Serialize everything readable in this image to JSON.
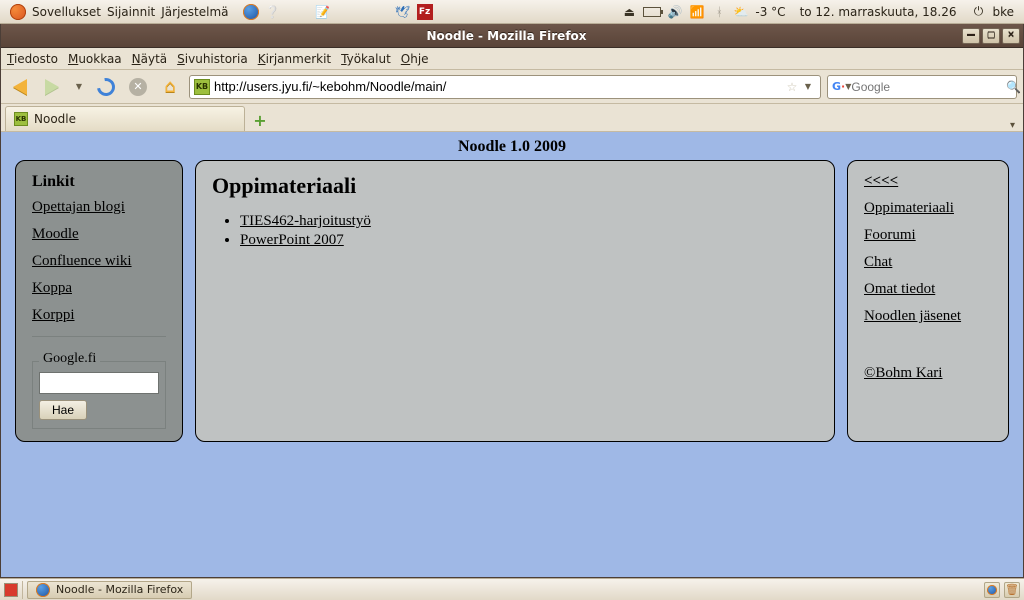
{
  "panel": {
    "menus": [
      "Sovellukset",
      "Sijainnit",
      "Järjestelmä"
    ],
    "temp": "-3 °C",
    "date": "to 12. marraskuuta, 18.26",
    "user": "bke"
  },
  "window": {
    "title": "Noodle - Mozilla Firefox",
    "menus": [
      {
        "accel": "T",
        "label": "iedosto"
      },
      {
        "accel": "M",
        "label": "uokkaa"
      },
      {
        "accel": "N",
        "label": "äytä"
      },
      {
        "accel": "S",
        "label": "ivuhistoria"
      },
      {
        "accel": "K",
        "label": "irjanmerkit"
      },
      {
        "accel": "T",
        "label": "yökalut"
      },
      {
        "accel": "O",
        "label": "hje"
      }
    ],
    "url": "http://users.jyu.fi/~kebohm/Noodle/main/",
    "search_placeholder": "Google",
    "tab_title": "Noodle"
  },
  "page": {
    "header": "Noodle 1.0 2009",
    "left": {
      "title": "Linkit",
      "links": [
        "Opettajan blogi",
        "Moodle",
        "Confluence wiki",
        "Koppa",
        "Korppi"
      ],
      "google_legend": "Google.fi",
      "google_button": "Hae",
      "google_value": ""
    },
    "center": {
      "title": "Oppimateriaali",
      "items": [
        "TIES462-harjoitustyö",
        "PowerPoint 2007"
      ]
    },
    "right": {
      "back": "<<<<",
      "links": [
        "Oppimateriaali",
        "Foorumi",
        "Chat",
        "Omat tiedot",
        "Noodlen jäsenet"
      ],
      "copyright": "©Bohm Kari"
    }
  },
  "taskbar": {
    "active": "Noodle - Mozilla Firefox"
  }
}
